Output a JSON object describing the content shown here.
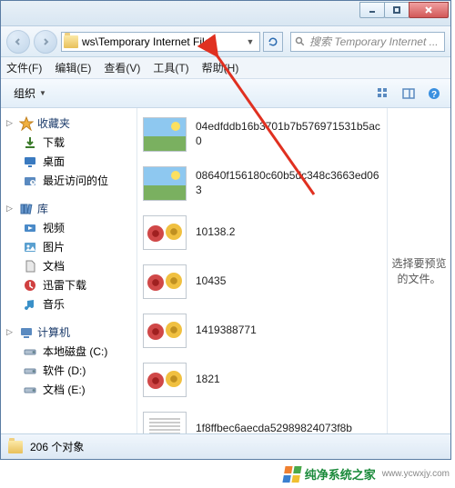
{
  "titlebar": {},
  "nav": {
    "address": "ws\\Temporary Internet Files",
    "search_placeholder": "搜索 Temporary Internet ..."
  },
  "menubar": {
    "file": "文件(F)",
    "edit": "编辑(E)",
    "view": "查看(V)",
    "tools": "工具(T)",
    "help": "帮助(H)"
  },
  "toolbar": {
    "organize": "组织"
  },
  "sidebar": {
    "favorites": {
      "label": "收藏夹"
    },
    "downloads": {
      "label": "下载"
    },
    "desktop": {
      "label": "桌面"
    },
    "recent": {
      "label": "最近访问的位"
    },
    "libraries": {
      "label": "库"
    },
    "videos": {
      "label": "视频"
    },
    "pictures": {
      "label": "图片"
    },
    "documents": {
      "label": "文档"
    },
    "xunlei": {
      "label": "迅雷下载"
    },
    "music": {
      "label": "音乐"
    },
    "computer": {
      "label": "计算机"
    },
    "drive_c": {
      "label": "本地磁盘 (C:)"
    },
    "drive_d": {
      "label": "软件 (D:)"
    },
    "drive_e": {
      "label": "文档 (E:)"
    }
  },
  "files": [
    {
      "name": "04edfddb16b3701b7b576971531b5ac0",
      "thumb": "landscape"
    },
    {
      "name": "08640f156180c60b5dc348c3663ed063",
      "thumb": "landscape"
    },
    {
      "name": "10138.2",
      "thumb": "flowers"
    },
    {
      "name": "10435",
      "thumb": "flowers"
    },
    {
      "name": "1419388771",
      "thumb": "flowers"
    },
    {
      "name": "1821",
      "thumb": "flowers"
    },
    {
      "name": "1f8ffbec6aecda52989824073f8b",
      "thumb": "blank"
    }
  ],
  "preview": {
    "text": "选择要预览的文件。"
  },
  "status": {
    "text": "206 个对象"
  },
  "watermark": {
    "brand": "纯净系统之家",
    "url": "www.ycwxjy.com"
  }
}
